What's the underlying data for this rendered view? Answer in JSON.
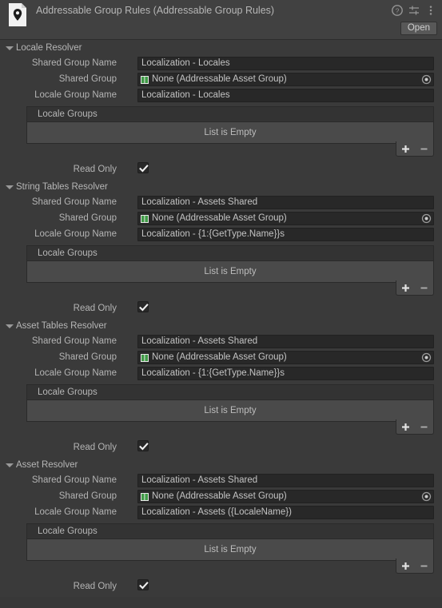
{
  "header": {
    "title": "Addressable Group Rules (Addressable Group Rules)",
    "asset_icon": "location-pin-asset-icon",
    "help_icon": "help-icon",
    "preset_icon": "preset-settings-icon",
    "menu_icon": "kebab-menu-icon",
    "open_label": "Open"
  },
  "labels": {
    "shared_group_name": "Shared Group Name",
    "shared_group": "Shared Group",
    "locale_group_name": "Locale Group Name",
    "locale_groups": "Locale Groups",
    "list_empty": "List is Empty",
    "read_only": "Read Only",
    "add_label": "+",
    "remove_label": "−"
  },
  "colors": {
    "panel_bg": "#3a3a3a",
    "header_bg": "#414141",
    "field_bg": "#282828",
    "list_head_bg": "#333333",
    "list_body_bg": "#4a4a4a",
    "text": "#b6b6b6",
    "button_bg": "#585858",
    "asset_group_icon": "#4caf50"
  },
  "sections": [
    {
      "title": "Locale Resolver",
      "expanded": true,
      "shared_group_name": "Localization - Locales",
      "shared_group": "None (Addressable Asset Group)",
      "locale_group_name": "Localization - Locales",
      "locale_groups_empty": "List is Empty",
      "read_only": true
    },
    {
      "title": "String Tables Resolver",
      "expanded": true,
      "shared_group_name": "Localization - Assets Shared",
      "shared_group": "None (Addressable Asset Group)",
      "locale_group_name": "Localization - {1:{GetType.Name}}s",
      "locale_groups_empty": "List is Empty",
      "read_only": true
    },
    {
      "title": "Asset Tables Resolver",
      "expanded": true,
      "shared_group_name": "Localization - Assets Shared",
      "shared_group": "None (Addressable Asset Group)",
      "locale_group_name": "Localization - {1:{GetType.Name}}s",
      "locale_groups_empty": "List is Empty",
      "read_only": true
    },
    {
      "title": "Asset Resolver",
      "expanded": true,
      "shared_group_name": "Localization - Assets Shared",
      "shared_group": "None (Addressable Asset Group)",
      "locale_group_name": "Localization - Assets ({LocaleName})",
      "locale_groups_empty": "List is Empty",
      "read_only": true
    }
  ]
}
